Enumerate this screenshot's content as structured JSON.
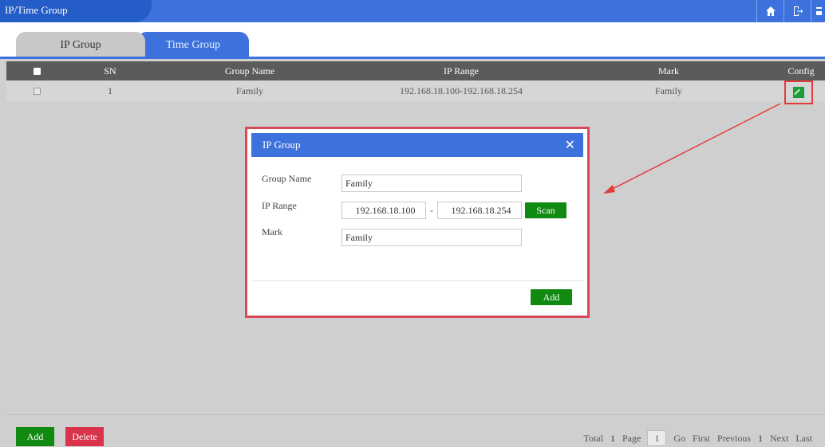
{
  "window": {
    "title": "IP/Time Group",
    "icons": [
      "home-icon",
      "logout-icon",
      "back-icon"
    ]
  },
  "tabs": [
    {
      "label": "IP Group",
      "active": true
    },
    {
      "label": "Time Group",
      "active": false
    }
  ],
  "table": {
    "columns": [
      "SN",
      "Group Name",
      "IP Range",
      "Mark",
      "Config"
    ],
    "rows": [
      {
        "sn": "1",
        "group_name": "Family",
        "ip_range": "192.168.18.100-192.168.18.254",
        "mark": "Family"
      }
    ]
  },
  "dialog": {
    "title": "IP Group",
    "group_name_label": "Group Name",
    "group_name_value": "Family",
    "ip_range_label": "IP Range",
    "ip_start": "192.168.18.100",
    "ip_dash": "-",
    "ip_end": "192.168.18.254",
    "scan_label": "Scan",
    "mark_label": "Mark",
    "mark_value": "Family",
    "add_label": "Add"
  },
  "actions": {
    "add_label": "Add",
    "delete_label": "Delete"
  },
  "pagination": {
    "total_label": "Total",
    "total": "1",
    "page_label": "Page",
    "page_value": "1",
    "go_label": "Go",
    "first_label": "First",
    "previous_label": "Previous",
    "current": "1",
    "next_label": "Next",
    "last_label": "Last"
  },
  "colors": {
    "header_blue": "#3d72dc",
    "green": "#108a10",
    "red": "#d8334a",
    "highlight_red": "#e23b3b"
  }
}
